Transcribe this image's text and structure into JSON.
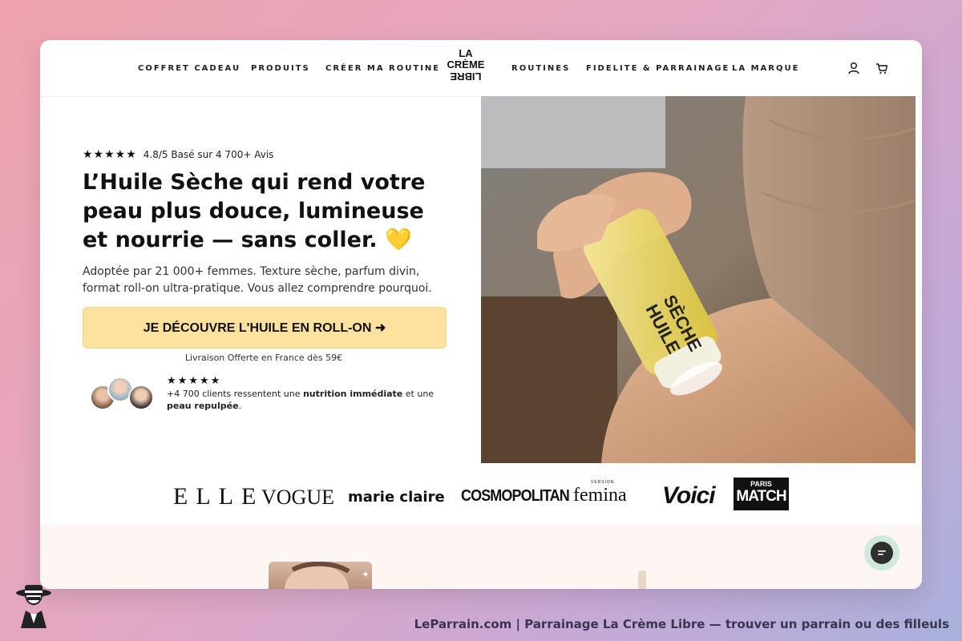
{
  "nav": {
    "left": [
      "COFFRET CADEAU",
      "PRODUITS",
      "CRÉER MA ROUTINE"
    ],
    "right": [
      "ROUTINES",
      "FIDELITE & PARRAINAGE",
      "LA MARQUE"
    ],
    "logo": {
      "line1": "LA",
      "line2": "CRÈME",
      "line3": "LIBRE"
    },
    "account_icon": "user-icon",
    "cart_icon": "cart-icon"
  },
  "hero": {
    "stars": "★★★★★",
    "rating_text": "4.8/5 Basé sur 4 700+ Avis",
    "title": "L’Huile Sèche qui rend votre peau plus douce, lumineuse et nourrie — sans coller. 💛",
    "subtitle": "Adoptée par 21 000+ femmes. Texture sèche, parfum divin, format roll-on ultra-pratique. Vous allez comprendre pourquoi.",
    "cta_label": "JE DÉCOUVRE L'HUILE EN ROLL-ON ➜",
    "shipping": "Livraison Offerte en France dès 59€",
    "proof": {
      "stars": "★★★★★",
      "part1": "+4 700 clients ressentent une ",
      "bold1": "nutrition immédiate",
      "part2": " et une ",
      "bold2": "peau repulpée",
      "part3": "."
    },
    "bottle_text": {
      "line1": "HUILE",
      "line2": "SÈCHE"
    },
    "accent": "#fde29f"
  },
  "press": [
    {
      "name": "ELLE"
    },
    {
      "name": "VOGUE"
    },
    {
      "name": "marie claire"
    },
    {
      "name": "COSMOPOLITAN"
    },
    {
      "name": "femina",
      "tag": "VERSION"
    },
    {
      "name": "Voici"
    },
    {
      "name": "MATCH",
      "tag": "PARIS"
    }
  ],
  "chat_icon": "chat-icon",
  "footer": {
    "caption": "LeParrain.com | Parrainage La Crème Libre — trouver un parrain ou des filleuls"
  }
}
